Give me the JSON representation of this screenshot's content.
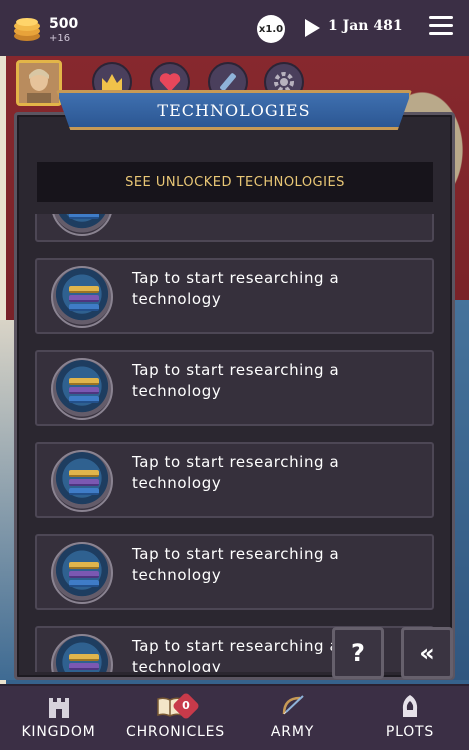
{
  "topbar": {
    "gold_amount": "500",
    "gold_delta": "+16",
    "speed": "x1.0",
    "date": "1 Jan 481"
  },
  "categories": [
    {
      "name": "crown-icon"
    },
    {
      "name": "heart-icon"
    },
    {
      "name": "science-icon"
    },
    {
      "name": "gear-icon"
    }
  ],
  "panel": {
    "title": "TECHNOLOGIES",
    "unlocked_button": "SEE UNLOCKED TECHNOLOGIES",
    "items": [
      {
        "text": "Tap to start researching a technology"
      },
      {
        "text": "Tap to start researching a technology"
      },
      {
        "text": "Tap to start researching a technology"
      },
      {
        "text": "Tap to start researching a technology"
      },
      {
        "text": "Tap to start researching a technology"
      }
    ]
  },
  "buttons": {
    "help": "?",
    "back": "«"
  },
  "nav": {
    "kingdom": "KINGDOM",
    "chronicles": "CHRONICLES",
    "chronicles_badge": "0",
    "army": "ARMY",
    "plots": "PLOTS"
  },
  "colors": {
    "accent_gold": "#e9c776",
    "title_blue": "#3f70b0",
    "panel_bg": "#2b2730",
    "bar_bg": "#3b2f45"
  }
}
